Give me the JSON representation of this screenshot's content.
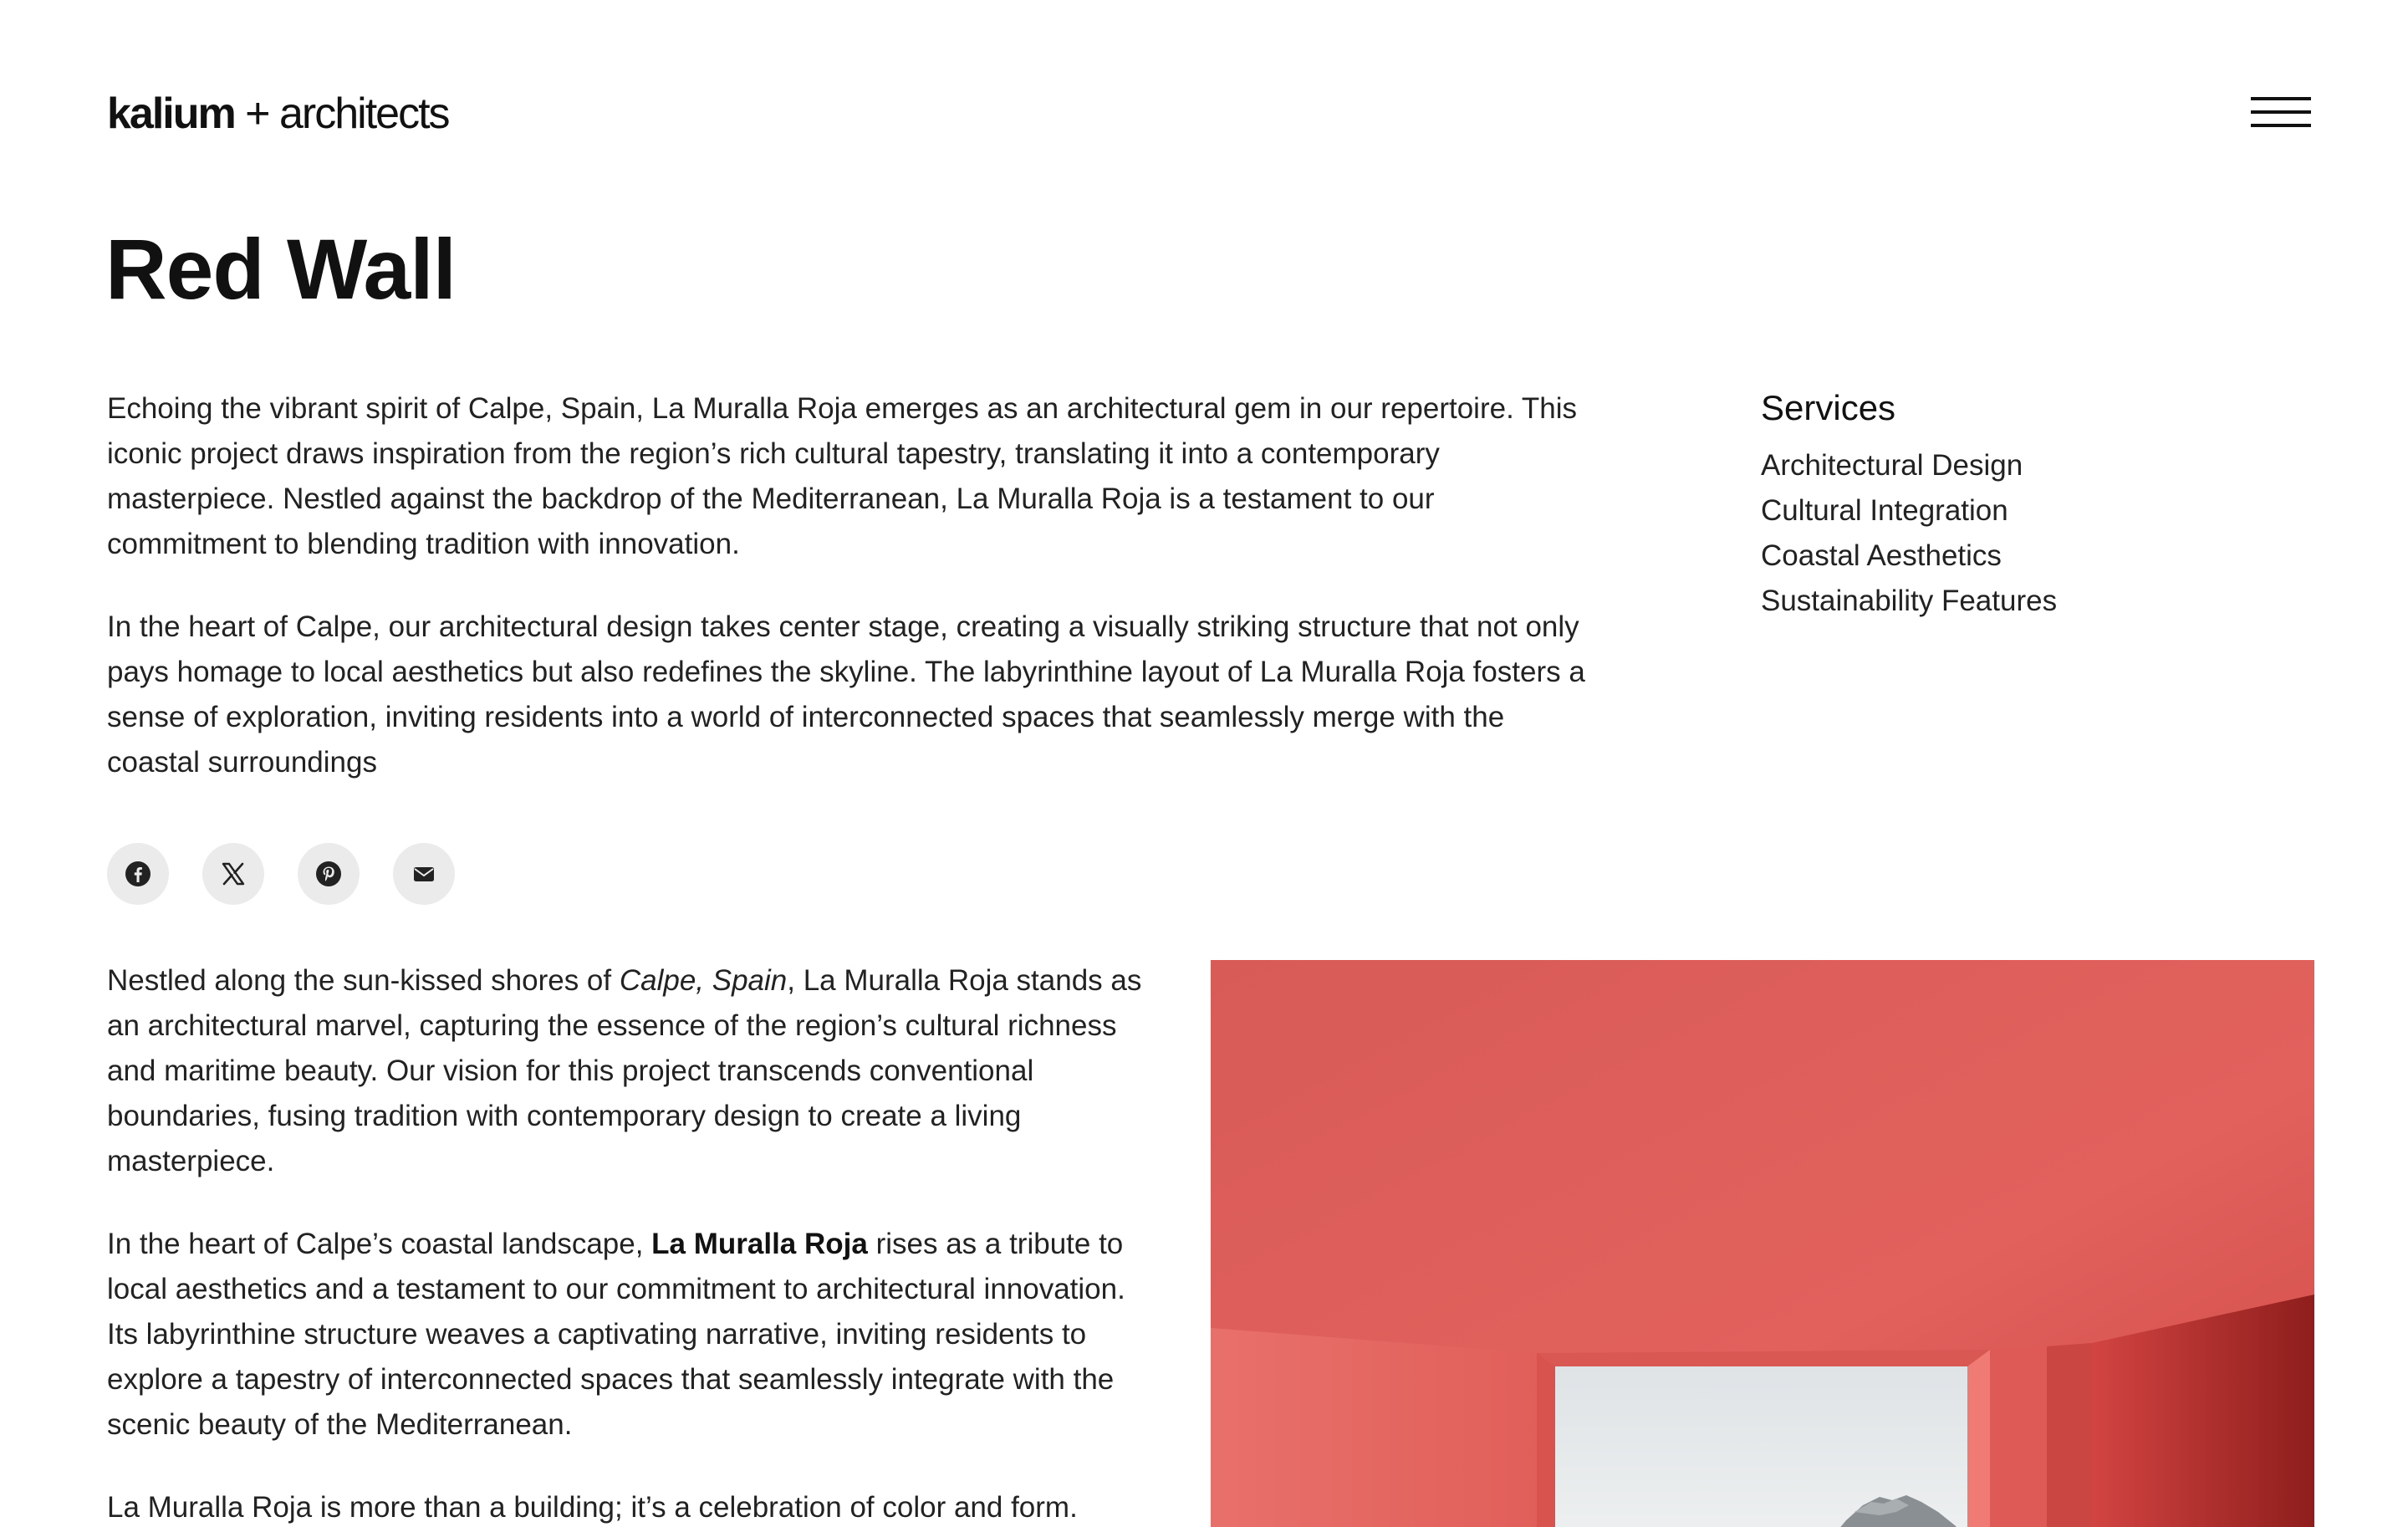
{
  "header": {
    "logo_brand": "kalium",
    "logo_rest": " + architects",
    "menu_icon": "hamburger-menu-icon"
  },
  "page": {
    "title": "Red Wall"
  },
  "intro": {
    "paragraphs": [
      "Echoing the vibrant spirit of Calpe, Spain, La Muralla Roja emerges as an architectural gem in our repertoire. This iconic project draws inspiration from the region’s rich cultural tapestry, translating it into a contemporary masterpiece. Nestled against the backdrop of the Mediterranean, La Muralla Roja is a testament to our commitment to blending tradition with innovation.",
      "In the heart of Calpe, our architectural design takes center stage, creating a visually striking structure that not only pays homage to local aesthetics but also redefines the skyline. The labyrinthine layout of La Muralla Roja fosters a sense of exploration, inviting residents into a world of interconnected spaces that seamlessly merge with the coastal surroundings"
    ]
  },
  "services": {
    "heading": "Services",
    "items": [
      "Architectural Design",
      "Cultural Integration",
      "Coastal Aesthetics",
      "Sustainability Features"
    ]
  },
  "share": {
    "icons": [
      "facebook-icon",
      "x-icon",
      "pinterest-icon",
      "email-icon"
    ]
  },
  "body": {
    "p1_before": "Nestled along the sun-kissed shores of ",
    "p1_italic": "Calpe, Spain",
    "p1_after": ", La Muralla Roja stands as an architectural marvel, capturing the essence of the region’s cultural richness and maritime beauty. Our vision for this project transcends conventional boundaries, fusing tradition with contemporary design to create a living masterpiece.",
    "p2_before": "In the heart of Calpe’s coastal landscape, ",
    "p2_bold": "La Muralla Roja",
    "p2_after": " rises as a tribute to local aesthetics and a testament to our commitment to architectural innovation. Its labyrinthine structure weaves a captivating narrative, inviting residents to explore a tapestry of interconnected spaces that seamlessly integrate with the scenic beauty of the Mediterranean.",
    "p3": "La Muralla Roja is more than a building; it’s a celebration of color and form."
  },
  "colors": {
    "wall_red": "#e0605c",
    "wall_dark": "#b8302e",
    "sky": "#e4e8ea",
    "share_bg": "#ebebeb"
  }
}
